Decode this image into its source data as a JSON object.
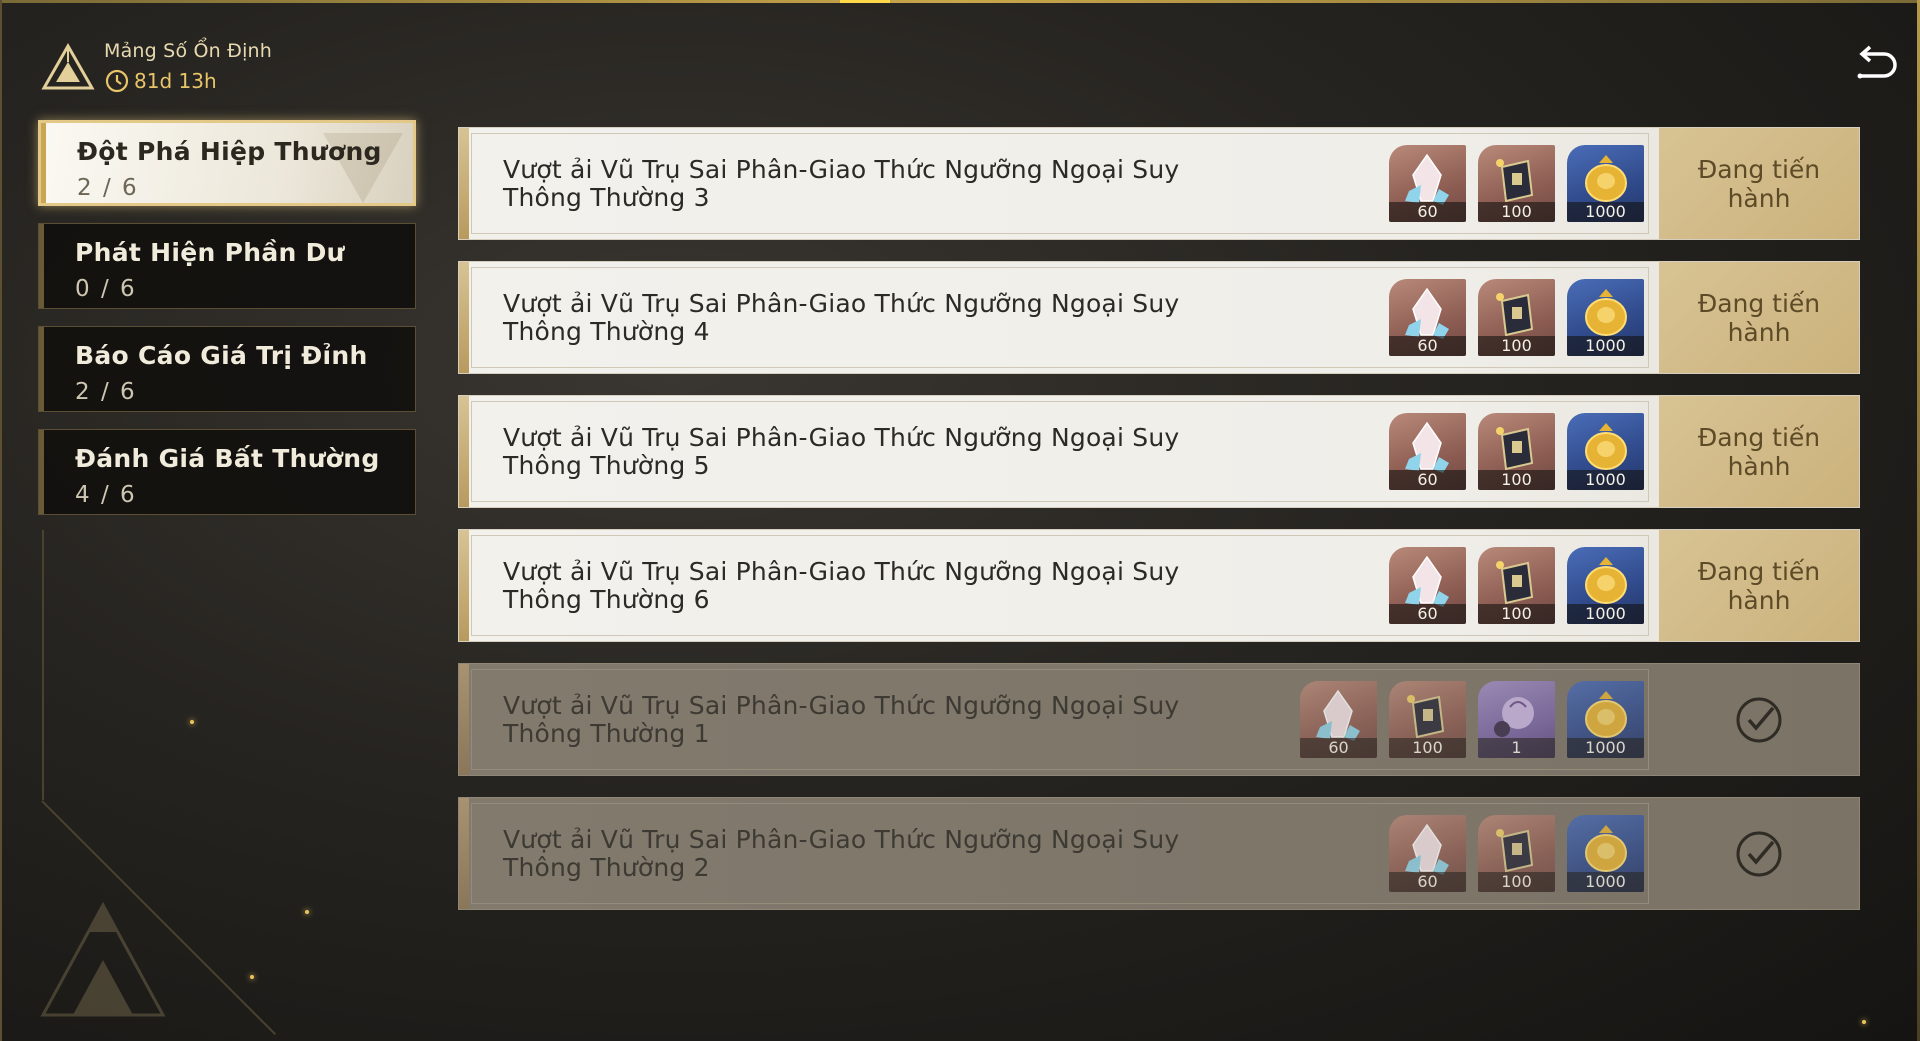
{
  "header": {
    "title": "Mảng Số Ổn Định",
    "timer": "81d 13h"
  },
  "sidebar": {
    "items": [
      {
        "label": "Đột Phá Hiệp Thương",
        "progress": "2 / 6",
        "active": true
      },
      {
        "label": "Phát Hiện Phần Dư",
        "progress": "0 / 6",
        "active": false
      },
      {
        "label": "Báo Cáo Giá Trị Đỉnh",
        "progress": "2 / 6",
        "active": false
      },
      {
        "label": "Đánh Giá Bất Thường",
        "progress": "4 / 6",
        "active": false
      }
    ]
  },
  "missions": [
    {
      "title": "Vượt ải Vũ Trụ Sai Phân-Giao Thức Ngưỡng Ngoại Suy Thông Thường 3",
      "rewards": [
        {
          "icon": "crystal-icon",
          "qty": "60"
        },
        {
          "icon": "book-icon",
          "qty": "100"
        },
        {
          "icon": "mora-icon",
          "qty": "1000"
        }
      ],
      "status": "Đang tiến hành",
      "completed": false
    },
    {
      "title": "Vượt ải Vũ Trụ Sai Phân-Giao Thức Ngưỡng Ngoại Suy Thông Thường 4",
      "rewards": [
        {
          "icon": "crystal-icon",
          "qty": "60"
        },
        {
          "icon": "book-icon",
          "qty": "100"
        },
        {
          "icon": "mora-icon",
          "qty": "1000"
        }
      ],
      "status": "Đang tiến hành",
      "completed": false
    },
    {
      "title": "Vượt ải Vũ Trụ Sai Phân-Giao Thức Ngưỡng Ngoại Suy Thông Thường 5",
      "rewards": [
        {
          "icon": "crystal-icon",
          "qty": "60"
        },
        {
          "icon": "book-icon",
          "qty": "100"
        },
        {
          "icon": "mora-icon",
          "qty": "1000"
        }
      ],
      "status": "Đang tiến hành",
      "completed": false
    },
    {
      "title": "Vượt ải Vũ Trụ Sai Phân-Giao Thức Ngưỡng Ngoại Suy Thông Thường 6",
      "rewards": [
        {
          "icon": "crystal-icon",
          "qty": "60"
        },
        {
          "icon": "book-icon",
          "qty": "100"
        },
        {
          "icon": "mora-icon",
          "qty": "1000"
        }
      ],
      "status": "Đang tiến hành",
      "completed": false
    },
    {
      "title": "Vượt ải Vũ Trụ Sai Phân-Giao Thức Ngưỡng Ngoại Suy Thông Thường 1",
      "rewards": [
        {
          "icon": "crystal-icon",
          "qty": "60"
        },
        {
          "icon": "book-icon",
          "qty": "100"
        },
        {
          "icon": "spirit-icon",
          "qty": "1"
        },
        {
          "icon": "mora-icon",
          "qty": "1000"
        }
      ],
      "status": "",
      "completed": true
    },
    {
      "title": "Vượt ải Vũ Trụ Sai Phân-Giao Thức Ngưỡng Ngoại Suy Thông Thường 2",
      "rewards": [
        {
          "icon": "crystal-icon",
          "qty": "60"
        },
        {
          "icon": "book-icon",
          "qty": "100"
        },
        {
          "icon": "mora-icon",
          "qty": "1000"
        }
      ],
      "status": "",
      "completed": true
    }
  ],
  "colors": {
    "accent_gold": "#c9a654",
    "status_bg": "#d8c394",
    "status_text": "#5d4b28",
    "card_bg": "#f0eee9",
    "card_done_bg": "#7f776a"
  }
}
